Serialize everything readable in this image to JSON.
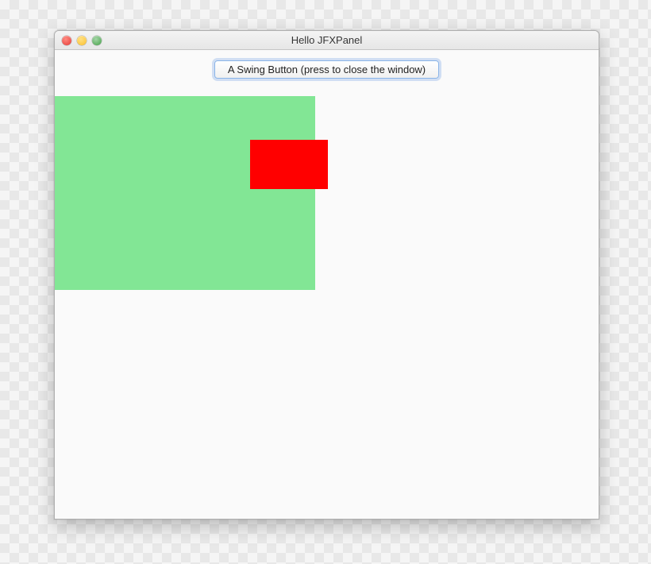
{
  "window": {
    "title": "Hello JFXPanel"
  },
  "button": {
    "label": "A Swing Button (press to close the window)"
  },
  "shapes": {
    "green": {
      "color": "#82e695"
    },
    "red": {
      "color": "#ff0000"
    }
  }
}
